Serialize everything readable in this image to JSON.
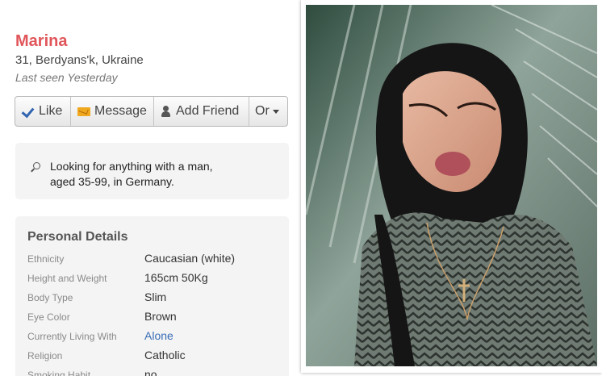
{
  "profile": {
    "name": "Marina",
    "location": "31, Berdyans'k, Ukraine",
    "last_seen": "Last seen Yesterday"
  },
  "actions": {
    "like": "Like",
    "message": "Message",
    "add_friend": "Add Friend",
    "or": "Or"
  },
  "looking_for": {
    "line1": "Looking for anything with a man,",
    "line2": "aged 35-99, in Germany."
  },
  "personal_details": {
    "heading": "Personal Details",
    "rows": [
      {
        "label": "Ethnicity",
        "value": "Caucasian (white)"
      },
      {
        "label": "Height and Weight",
        "value": "165cm 50Kg"
      },
      {
        "label": "Body Type",
        "value": "Slim"
      },
      {
        "label": "Eye Color",
        "value": "Brown"
      },
      {
        "label": "Currently Living With",
        "value": "Alone"
      },
      {
        "label": "Religion",
        "value": "Catholic"
      },
      {
        "label": "Smoking Habit",
        "value": "no"
      }
    ]
  },
  "colors": {
    "name": "#e0565a",
    "link": "#3a6db5",
    "panel_bg": "#f4f4f4"
  }
}
